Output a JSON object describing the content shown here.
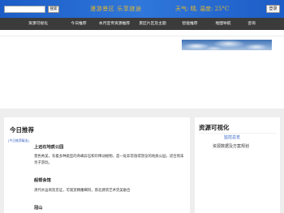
{
  "header": {
    "search_button": "搜索",
    "slogan": "漫游景区 乐享旅途",
    "weather": "天气: 晴, 温度: 25°C",
    "login_button": "登录"
  },
  "nav": {
    "items": [
      "资源可视化",
      "今日推荐",
      "本月宣传资源推荐",
      "景区片区及主题",
      "智能推荐",
      "地图导航",
      "咨询"
    ]
  },
  "today": {
    "title": "今日推荐",
    "tag": "[今日推荐精选]",
    "items": [
      {
        "name": "上远石地质公园",
        "desc": "景色秀美，有着多种类型的奇峰异石和珍稀动植物，是一处非常值得游览的地质公园，适合周末亲子游玩。"
      },
      {
        "name": "船帮会馆",
        "desc": "清代水运商贸见证，可观赏精雕细刻，南北建筑艺术完美融合"
      },
      {
        "name": "冠山"
      }
    ]
  },
  "visualization": {
    "title": "资源可视化",
    "link": "监控总览",
    "text": "资源数据及方案规划"
  },
  "theme": {
    "header_blue": "#2a6fd4",
    "nav_bg": "#3b3b3b",
    "header_text": "#e8b92a",
    "link_blue": "#2d5fc4",
    "page_bg": "#eeeeee"
  }
}
